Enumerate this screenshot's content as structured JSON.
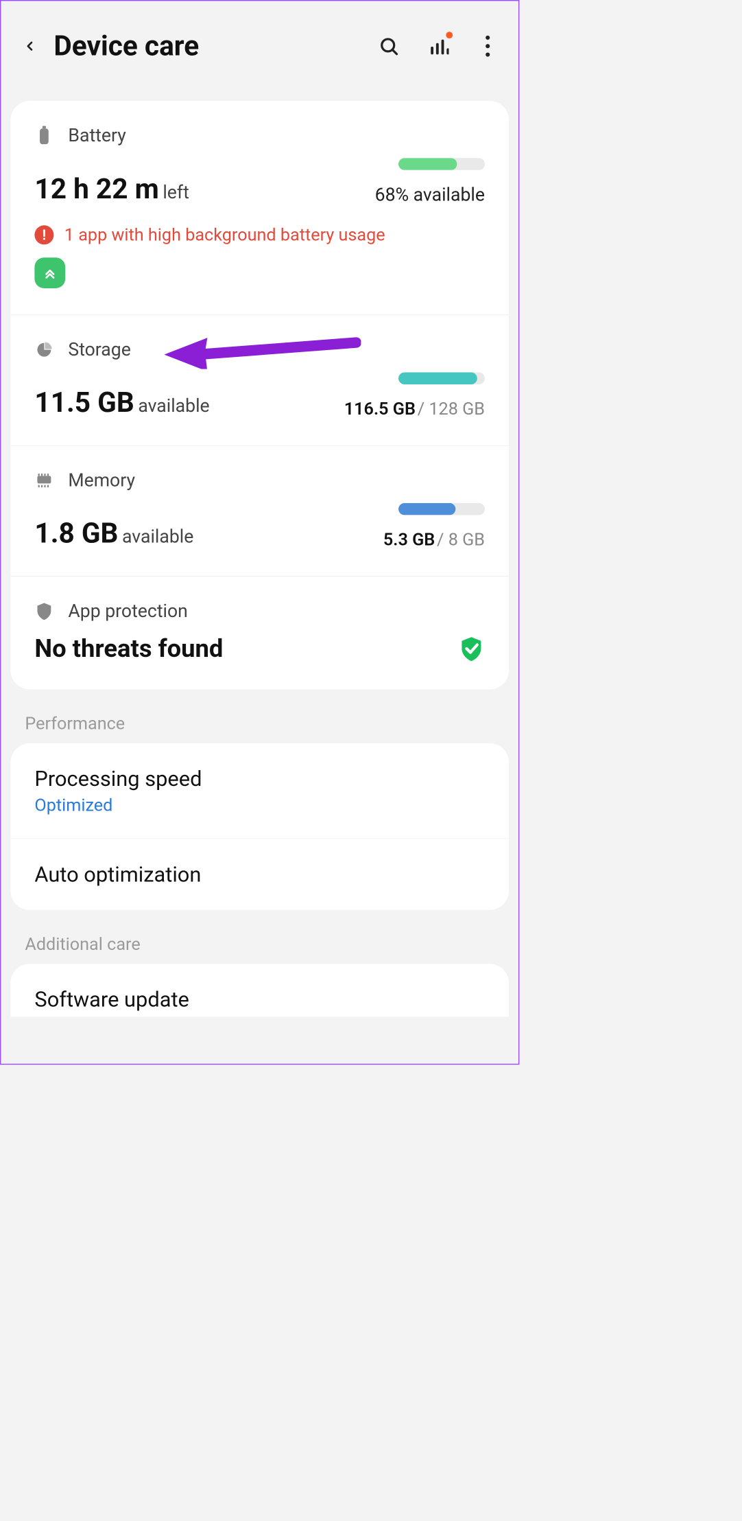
{
  "header": {
    "title": "Device care"
  },
  "battery": {
    "label": "Battery",
    "value": "12 h 22 m",
    "suffix": "left",
    "percent_text": "68% available",
    "bar_percent": 68,
    "bar_color": "#6bd98a",
    "warning": "1 app with high background battery usage"
  },
  "storage": {
    "label": "Storage",
    "value": "11.5 GB",
    "suffix": "available",
    "used": "116.5 GB",
    "total": "128 GB",
    "bar_percent": 91,
    "bar_color": "#45c6c0"
  },
  "memory": {
    "label": "Memory",
    "value": "1.8 GB",
    "suffix": "available",
    "used": "5.3 GB",
    "total": "8 GB",
    "bar_percent": 66,
    "bar_color": "#4f8fd9"
  },
  "protection": {
    "label": "App protection",
    "status": "No threats found"
  },
  "groups": {
    "performance": {
      "label": "Performance",
      "items": [
        {
          "title": "Processing speed",
          "sub": "Optimized"
        },
        {
          "title": "Auto optimization",
          "sub": ""
        }
      ]
    },
    "additional": {
      "label": "Additional care",
      "items": [
        {
          "title": "Software update",
          "sub": ""
        }
      ]
    }
  }
}
